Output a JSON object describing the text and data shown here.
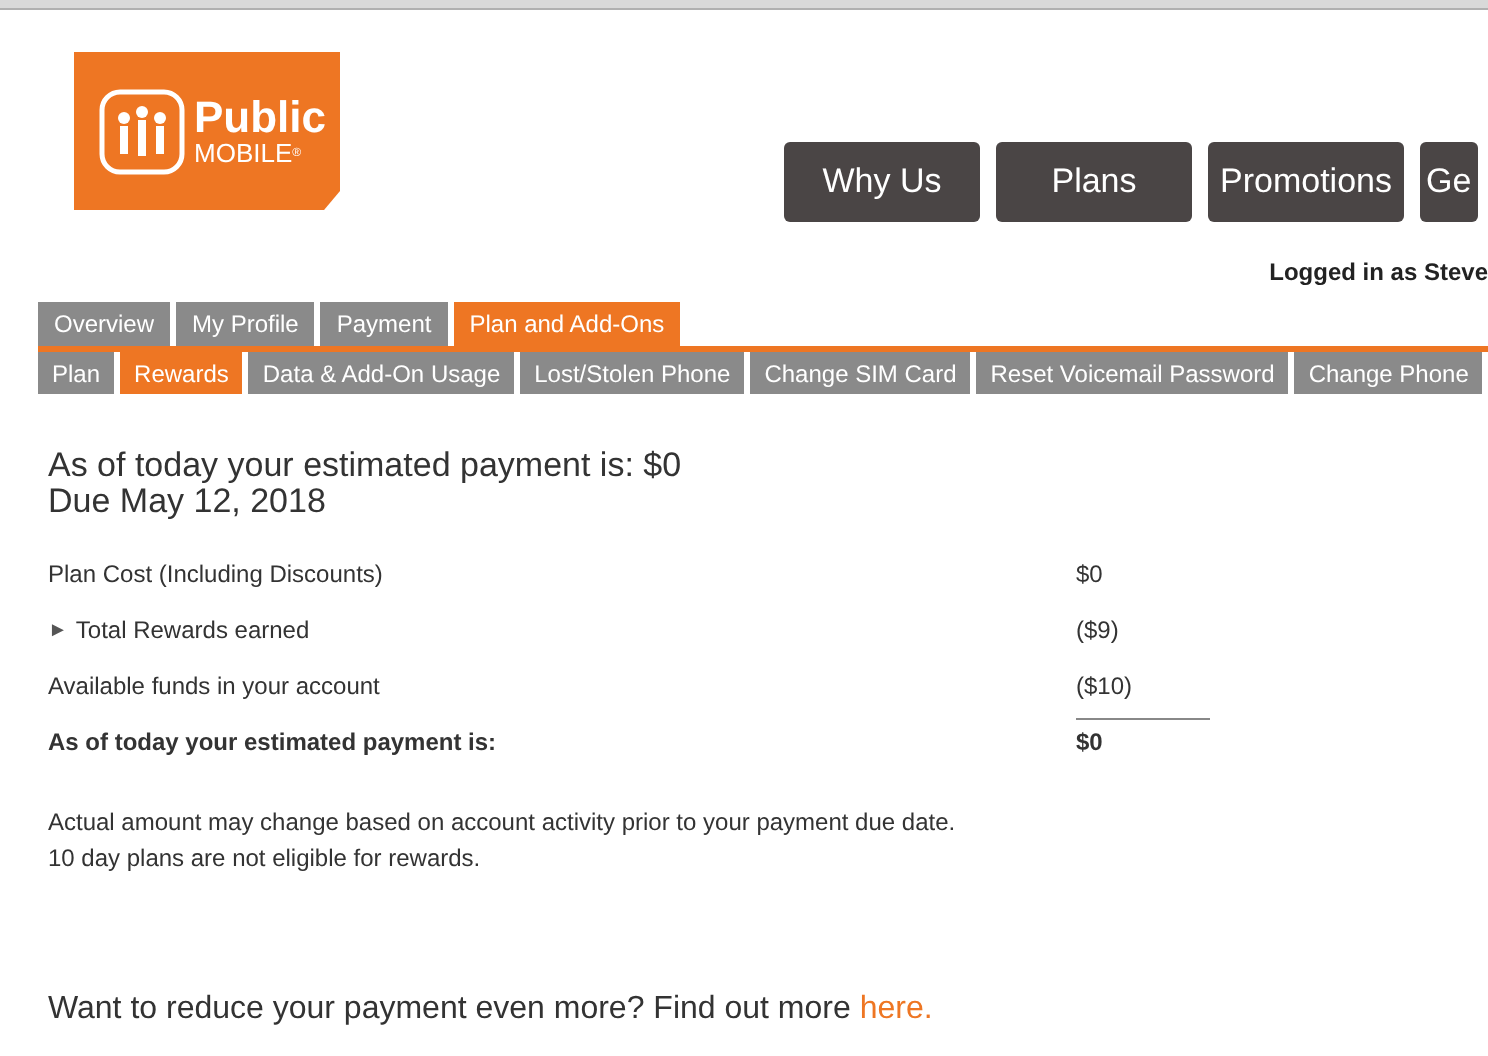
{
  "logo": {
    "line1": "Public",
    "line2": "MOBILE",
    "mark": "®"
  },
  "nav": [
    "Why Us",
    "Plans",
    "Promotions",
    "Ge"
  ],
  "user": "Logged in as Steve",
  "tabs": [
    {
      "label": "Overview",
      "selected": false
    },
    {
      "label": "My Profile",
      "selected": false
    },
    {
      "label": "Payment",
      "selected": false
    },
    {
      "label": "Plan and Add-Ons",
      "selected": true
    }
  ],
  "subtabs": [
    {
      "label": "Plan",
      "selected": false
    },
    {
      "label": "Rewards",
      "selected": true
    },
    {
      "label": "Data & Add-On Usage",
      "selected": false
    },
    {
      "label": "Lost/Stolen Phone",
      "selected": false
    },
    {
      "label": "Change SIM Card",
      "selected": false
    },
    {
      "label": "Reset Voicemail Password",
      "selected": false
    },
    {
      "label": "Change Phone",
      "selected": false
    }
  ],
  "heading": [
    "As of today your estimated payment is: $0",
    "Due May 12, 2018"
  ],
  "rows": [
    {
      "kind": "plain",
      "label": "Plan Cost (Including Discounts)",
      "value": "$0"
    },
    {
      "kind": "expandable",
      "toggle": "►",
      "label": "Total Rewards earned",
      "value": "($9)"
    },
    {
      "kind": "plain",
      "label": "Available funds in your account",
      "value": "($10)"
    },
    {
      "kind": "total",
      "label": "As of today your estimated payment is:",
      "value": "$0"
    }
  ],
  "notes": [
    "Actual amount may change based on account activity prior to your payment due date.",
    "10 day plans are not eligible for rewards."
  ],
  "promo": {
    "text": "Want to reduce your payment even more? Find out more ",
    "link": "here."
  }
}
